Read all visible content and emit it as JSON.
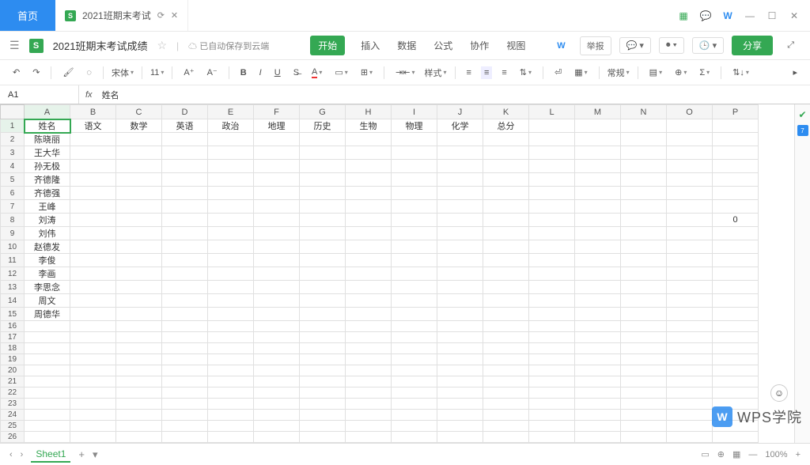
{
  "titlebar": {
    "home": "首页",
    "tab_label": "2021班期末考试",
    "window_controls": [
      "—",
      "☐",
      "✕"
    ]
  },
  "doc": {
    "title": "2021班期末考试成绩",
    "save_status": "已自动保存到云端"
  },
  "menus": [
    "开始",
    "插入",
    "数据",
    "公式",
    "协作",
    "视图"
  ],
  "header_actions": {
    "report": "举报",
    "share": "分享"
  },
  "toolbar": {
    "font": "宋体",
    "font_size": "11",
    "style_label": "样式",
    "normal": "常规"
  },
  "formula": {
    "cell_ref": "A1",
    "value": "姓名"
  },
  "columns": [
    "A",
    "B",
    "C",
    "D",
    "E",
    "F",
    "G",
    "H",
    "I",
    "J",
    "K",
    "L",
    "M",
    "N",
    "O",
    "P"
  ],
  "row_count": 26,
  "header_row": [
    "姓名",
    "语文",
    "数学",
    "英语",
    "政治",
    "地理",
    "历史",
    "生物",
    "物理",
    "化学",
    "总分",
    "",
    "",
    "",
    "",
    ""
  ],
  "names": [
    "陈晓丽",
    "王大华",
    "孙无极",
    "齐德隆",
    "齐德强",
    "王峰",
    "刘涛",
    "刘伟",
    "赵德发",
    "李俊",
    "李画",
    "李思念",
    "周文",
    "周德华"
  ],
  "extra_cell": {
    "row": 8,
    "col": 16,
    "value": "0"
  },
  "sheet": {
    "name": "Sheet1"
  },
  "status": {
    "zoom": "100%"
  },
  "watermark": {
    "logo": "W",
    "text": "WPS学院"
  }
}
